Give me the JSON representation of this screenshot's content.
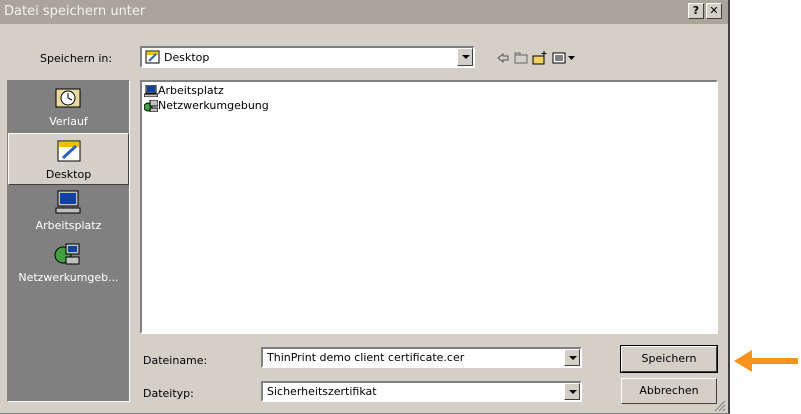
{
  "window": {
    "title": "Datei speichern unter",
    "help_label": "?",
    "close_label": "✕"
  },
  "save_in": {
    "label": "Speichern in:",
    "value": "Desktop"
  },
  "places": [
    {
      "label": "Verlauf",
      "icon": "history-icon"
    },
    {
      "label": "Desktop",
      "icon": "desktop-icon"
    },
    {
      "label": "Arbeitsplatz",
      "icon": "computer-icon"
    },
    {
      "label": "Netzwerkumgeb...",
      "icon": "network-icon"
    }
  ],
  "files": [
    {
      "name": "Arbeitsplatz",
      "icon": "computer-icon"
    },
    {
      "name": "Netzwerkumgebung",
      "icon": "network-icon"
    }
  ],
  "filename": {
    "label": "Dateiname:",
    "value": "ThinPrint demo client certificate.cer"
  },
  "filetype": {
    "label": "Dateityp:",
    "value": "Sicherheitszertifikat"
  },
  "buttons": {
    "save": "Speichern",
    "cancel": "Abbrechen"
  },
  "colors": {
    "accent_arrow": "#f7931e",
    "title_bar": "#a9a59b",
    "places_bg": "#808080"
  }
}
